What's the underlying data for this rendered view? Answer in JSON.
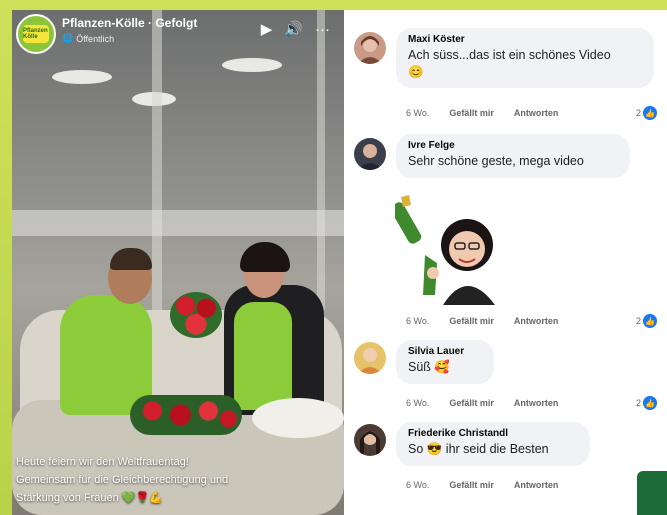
{
  "video": {
    "page_name": "Pflanzen-Kölle · Gefolgt",
    "visibility": "Öffentlich",
    "logo_text": "Pflanzen Kölle",
    "caption_lines": [
      "Heute feiern wir den Weltfrauentag!",
      "Gemeinsam für die Gleichberechtigung und",
      "Stärkung von Frauen 💚🌹💪"
    ],
    "controls": {
      "play": "▶",
      "volume": "🔊",
      "more": "···"
    }
  },
  "comments": [
    {
      "author": "Maxi Köster",
      "text_lines": [
        "Ach süss...das ist ein schönes Video",
        "😊"
      ],
      "time": "6 Wo.",
      "like_label": "Gefällt mir",
      "reply_label": "Antworten",
      "reactions": "2"
    },
    {
      "author": "Ivre Felge",
      "text_lines": [
        "Sehr schöne geste, mega video"
      ],
      "time": "6 Wo.",
      "like_label": "Gefällt mir",
      "reply_label": "Antworten",
      "reactions": "2"
    },
    {
      "author": "Silvia Lauer",
      "text_lines": [
        "Süß 🥰"
      ],
      "time": "6 Wo.",
      "like_label": "Gefällt mir",
      "reply_label": "Antworten",
      "reactions": "2"
    },
    {
      "author": "Friederike Christandl",
      "text_lines": [
        "So 😎 ihr seid die Besten"
      ],
      "time": "6 Wo.",
      "like_label": "Gefällt mir",
      "reply_label": "Antworten",
      "reactions": ""
    }
  ],
  "colors": {
    "accent": "#8ccc3a",
    "like": "#1877f2",
    "bubble": "#f0f2f5"
  }
}
